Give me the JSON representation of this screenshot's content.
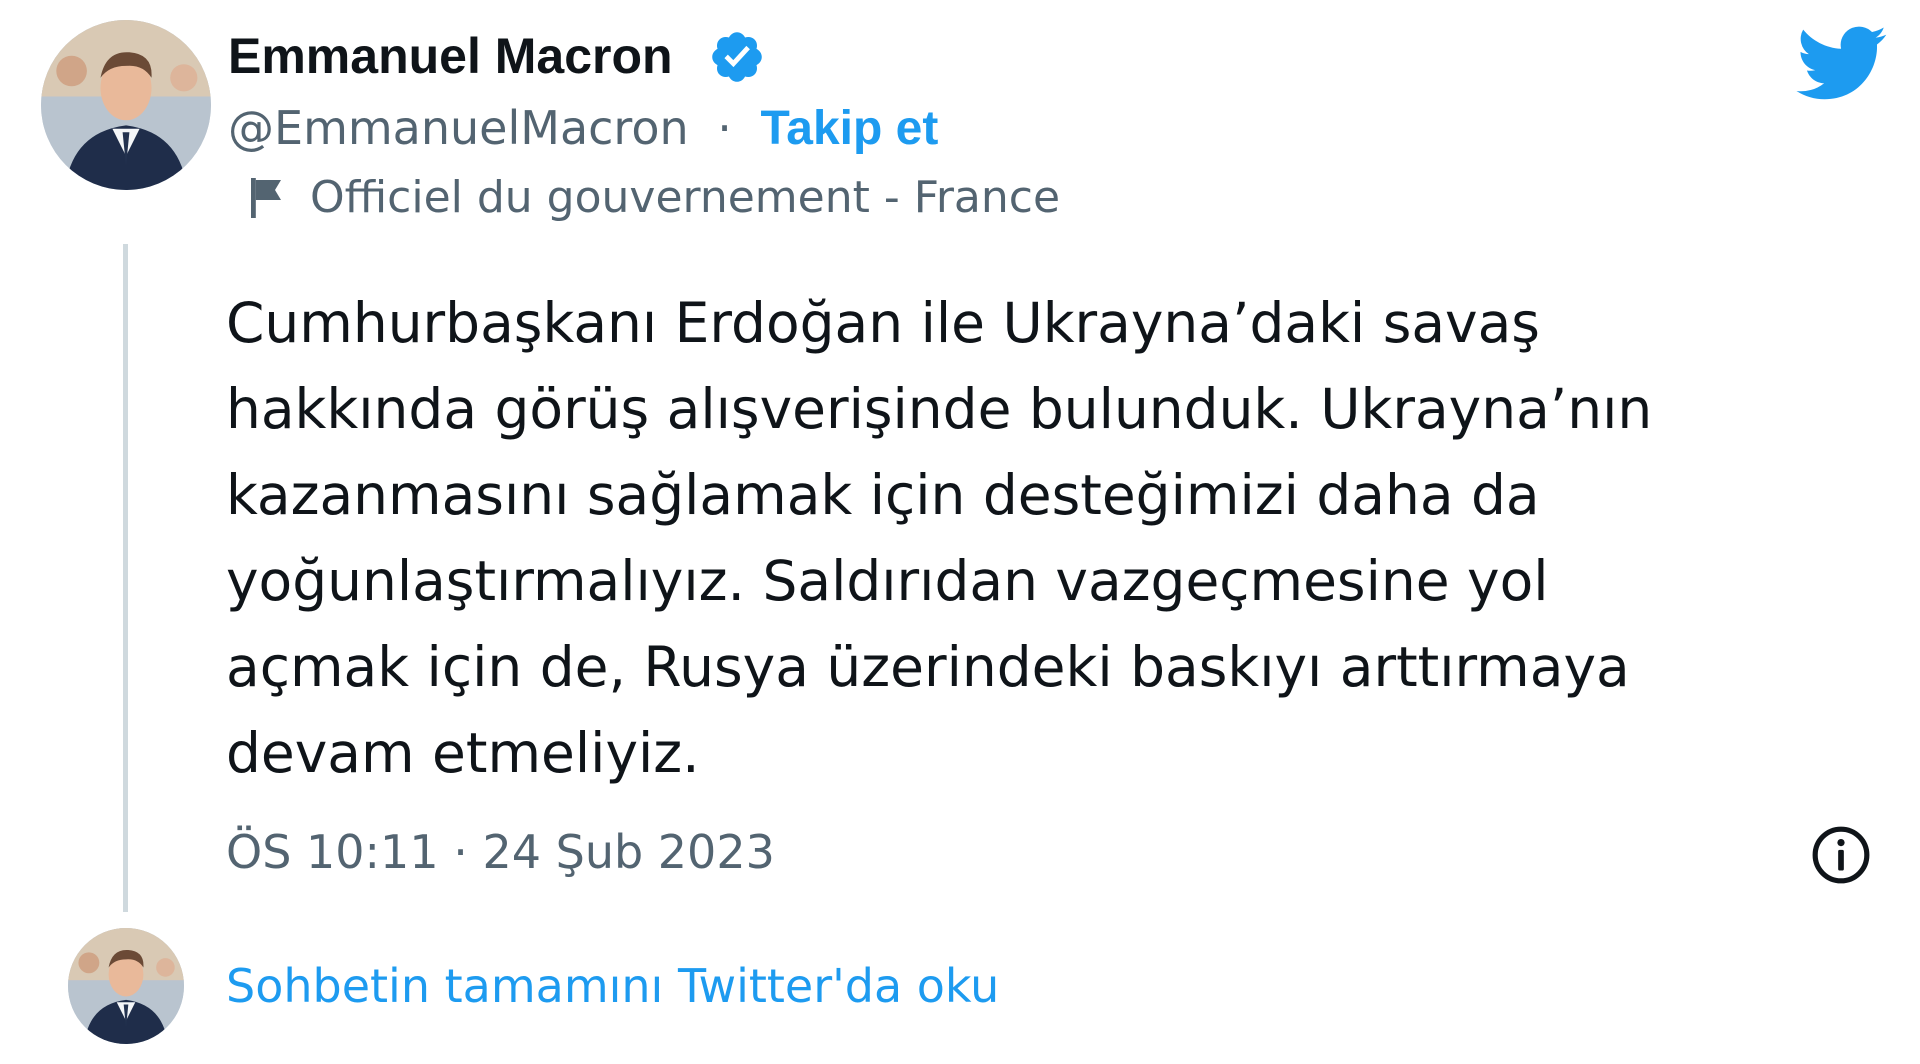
{
  "author": {
    "name": "Emmanuel Macron",
    "handle": "@EmmanuelMacron",
    "separator": "·",
    "follow_label": "Takip et",
    "affiliation": "Officiel du gouvernement - France",
    "verified": true
  },
  "tweet": {
    "lines": [
      "Cumhurbaşkanı Erdoğan ile Ukrayna’daki savaş",
      "hakkında görüş alışverişinde bulunduk. Ukrayna’nın",
      "kazanmasını sağlamak için desteğimizi daha da",
      "yoğunlaştırmalıyız. Saldırıdan vazgeçmesine yol",
      "açmak için de, Rusya üzerindeki baskıyı arttırmaya",
      "devam etmeliyiz."
    ],
    "timestamp": "ÖS 10:11 · 24 Şub 2023"
  },
  "footer": {
    "read_more": "Sohbetin tamamını Twitter'da oku"
  },
  "icons": {
    "verified": "verified-badge-icon",
    "flag": "flag-icon",
    "brand": "twitter-bird-icon",
    "info": "info-icon"
  },
  "colors": {
    "accent": "#1d9bf0",
    "text_primary": "#0f1419",
    "text_secondary": "#536471",
    "thread_line": "#cfd9de"
  }
}
